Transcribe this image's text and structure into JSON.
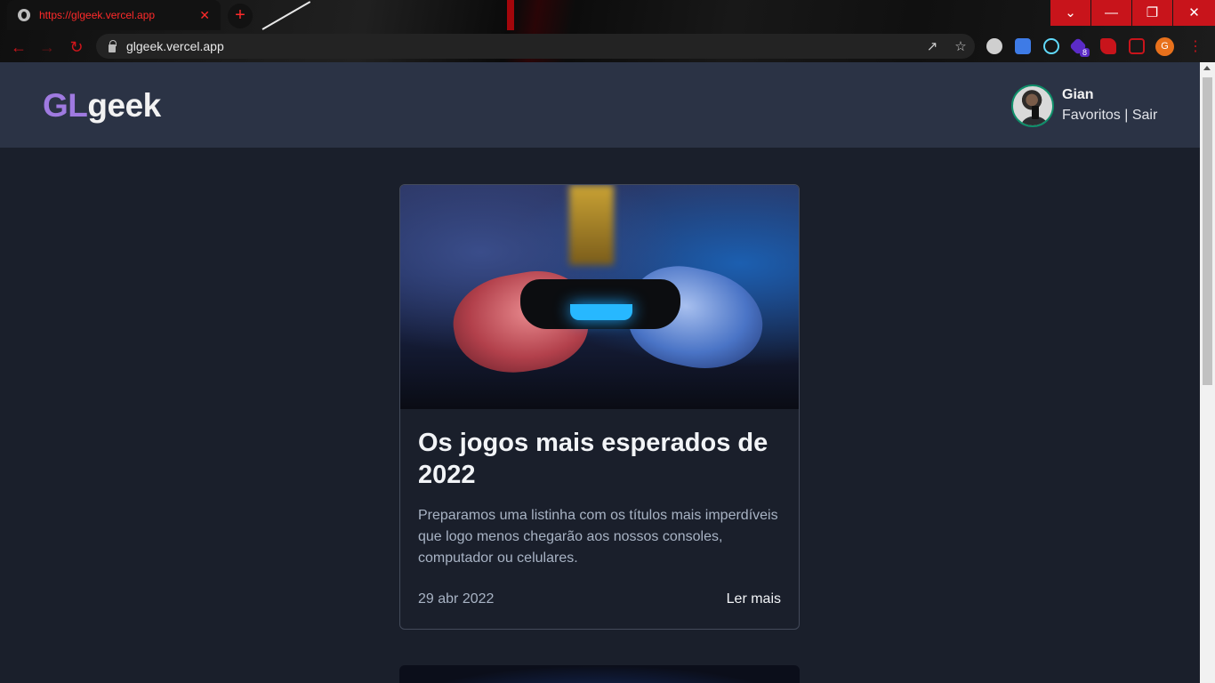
{
  "browser": {
    "tab_title": "https://glgeek.vercel.app",
    "tab_close": "✕",
    "new_tab": "+",
    "url": "glgeek.vercel.app",
    "window_controls": [
      "⌄",
      "—",
      "❐",
      "✕"
    ],
    "profile_initial": "G",
    "extension_badge": "8",
    "accent_color": "#c8141b"
  },
  "site": {
    "logo_gl": "GL",
    "logo_rest": "geek",
    "logo_gl_color": "#9f7ae0",
    "user": {
      "name": "Gian",
      "favorites_label": "Favoritos",
      "separator": " | ",
      "logout_label": "Sair"
    }
  },
  "posts": [
    {
      "title": "Os jogos mais esperados de 2022",
      "description": "Preparamos uma listinha com os títulos mais imperdíveis que logo menos chegarão aos nossos consoles, computador ou celulares.",
      "date": "29 abr 2022",
      "read_more": "Ler mais"
    }
  ]
}
